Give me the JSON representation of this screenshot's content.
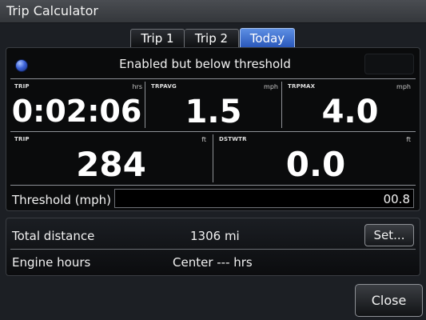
{
  "window": {
    "title": "Trip Calculator"
  },
  "tabs": [
    {
      "label": "Trip 1",
      "active": false
    },
    {
      "label": "Trip 2",
      "active": false
    },
    {
      "label": "Today",
      "active": true
    }
  ],
  "status": {
    "text": "Enabled but below threshold",
    "indicator_color": "#3d63d8"
  },
  "gauges": {
    "trip_time": {
      "label": "TRIP",
      "unit": "hrs",
      "value": "0:02:06"
    },
    "trip_avg": {
      "label": "TRPAVG",
      "unit": "mph",
      "value": "1.5"
    },
    "trip_max": {
      "label": "TRPMAX",
      "unit": "mph",
      "value": "4.0"
    },
    "trip_distance": {
      "label": "TRIP",
      "unit": "ft",
      "value": "284"
    },
    "distance_to_water": {
      "label": "DSTWTR",
      "unit": "ft",
      "value": "0.0"
    }
  },
  "threshold": {
    "label": "Threshold (mph)",
    "value": "00.8"
  },
  "totals": {
    "distance_label": "Total distance",
    "distance_value": "1306 mi",
    "set_label": "Set...",
    "engine_label": "Engine hours",
    "engine_value": "Center --- hrs"
  },
  "footer": {
    "close_label": "Close"
  },
  "colors": {
    "active_tab": "#3a6ed0",
    "panel_bg": "#0a0b0c",
    "window_bg": "#1c1f24"
  }
}
